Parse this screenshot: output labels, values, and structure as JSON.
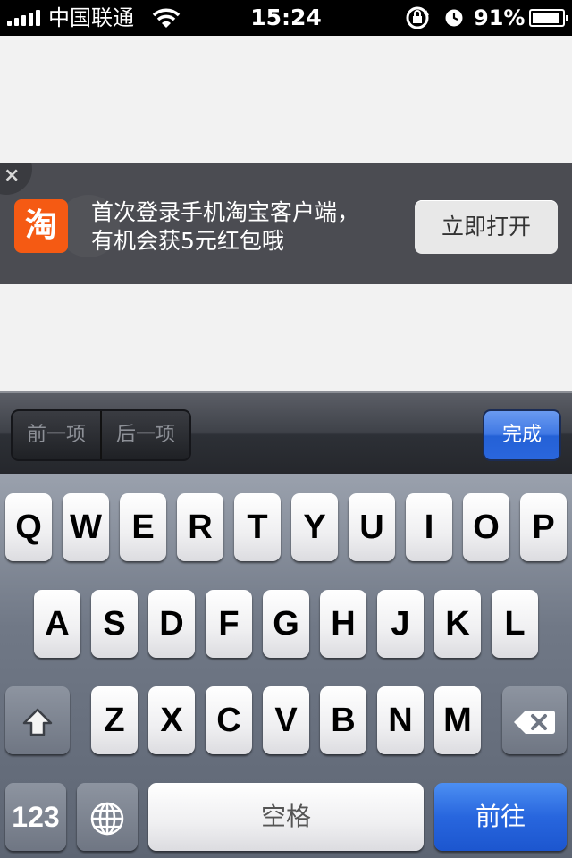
{
  "status_bar": {
    "carrier": "中国联通",
    "time": "15:24",
    "battery_percent": "91%",
    "battery_level": 0.91,
    "icons": [
      "signal-icon",
      "wifi-icon",
      "rotation-lock-icon",
      "alarm-icon",
      "battery-icon"
    ]
  },
  "banner": {
    "close_symbol": "×",
    "app_icon_glyph": "淘",
    "line1": "首次登录手机淘宝客户端，",
    "line2": "有机会获5元红包哦",
    "button_label": "立即打开"
  },
  "toolbar": {
    "prev_label": "前一项",
    "next_label": "后一项",
    "done_label": "完成"
  },
  "keyboard": {
    "row1": [
      "Q",
      "W",
      "E",
      "R",
      "T",
      "Y",
      "U",
      "I",
      "O",
      "P"
    ],
    "row2": [
      "A",
      "S",
      "D",
      "F",
      "G",
      "H",
      "J",
      "K",
      "L"
    ],
    "row3": [
      "Z",
      "X",
      "C",
      "V",
      "B",
      "N",
      "M"
    ],
    "numbers_label": "123",
    "space_label": "空格",
    "go_label": "前往"
  },
  "colors": {
    "taobao_orange": "#f55a13",
    "banner_bg": "#4b4c52",
    "accent_blue": "#2866de"
  }
}
